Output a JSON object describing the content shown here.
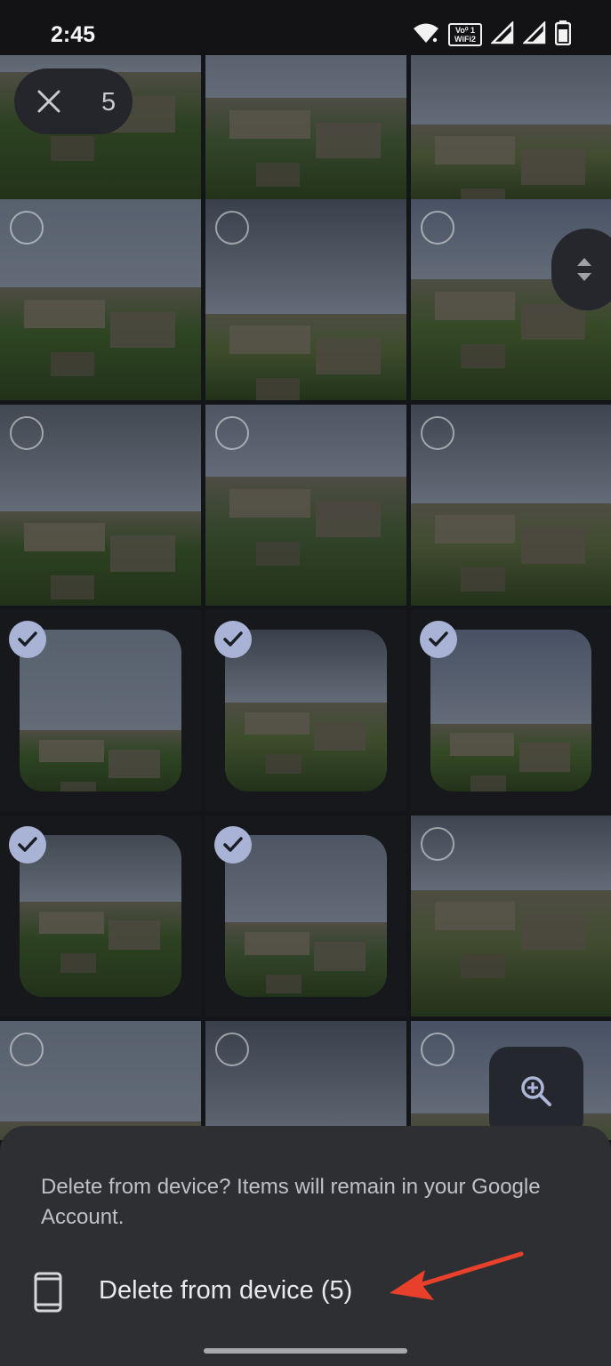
{
  "status_bar": {
    "time": "2:45",
    "volte_top": "Vo⁰ 1",
    "volte_bottom": "WiFi2",
    "icons": [
      "wifi-icon",
      "volte-wifi-calling-icon",
      "signal-icon",
      "signal-icon",
      "battery-icon"
    ]
  },
  "selection": {
    "close_icon": "close-icon",
    "count": "5"
  },
  "grid": {
    "tiles": [
      {
        "selected": false,
        "checkbox_visible": false
      },
      {
        "selected": false,
        "checkbox_visible": false
      },
      {
        "selected": false,
        "checkbox_visible": false
      },
      {
        "selected": false,
        "checkbox_visible": true
      },
      {
        "selected": false,
        "checkbox_visible": true
      },
      {
        "selected": false,
        "checkbox_visible": true
      },
      {
        "selected": false,
        "checkbox_visible": true
      },
      {
        "selected": false,
        "checkbox_visible": true
      },
      {
        "selected": false,
        "checkbox_visible": true
      },
      {
        "selected": true,
        "checkbox_visible": true
      },
      {
        "selected": true,
        "checkbox_visible": true
      },
      {
        "selected": true,
        "checkbox_visible": true
      },
      {
        "selected": true,
        "checkbox_visible": true
      },
      {
        "selected": true,
        "checkbox_visible": true
      },
      {
        "selected": false,
        "checkbox_visible": true
      },
      {
        "selected": false,
        "checkbox_visible": true
      },
      {
        "selected": false,
        "checkbox_visible": true
      },
      {
        "selected": false,
        "checkbox_visible": true
      }
    ]
  },
  "fast_scroll": {
    "icon": "drag-handle-icon"
  },
  "zoom_fab": {
    "icon": "zoom-in-icon"
  },
  "sheet": {
    "message": "Delete from device? Items will remain in your Google Account.",
    "delete_label": "Delete from device (5)",
    "device_icon": "smartphone-icon"
  },
  "annotation": {
    "arrow_color": "#e8402a"
  },
  "colors": {
    "background": "#141518",
    "sheet": "#2e2f33",
    "check_accent": "#a9b3d6",
    "sky": "#6f7b8c",
    "grass": "#3f6b2a"
  }
}
